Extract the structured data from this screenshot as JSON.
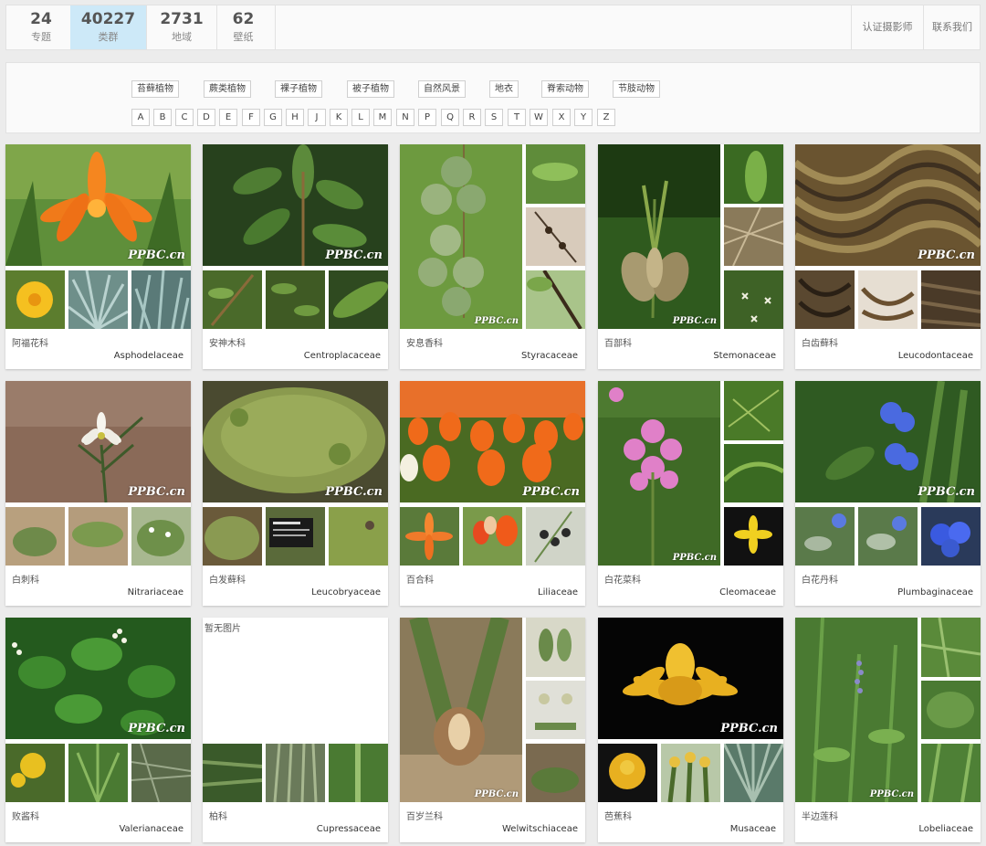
{
  "stats": [
    {
      "num": "24",
      "label": "专题"
    },
    {
      "num": "40227",
      "label": "类群",
      "active": true
    },
    {
      "num": "2731",
      "label": "地域"
    },
    {
      "num": "62",
      "label": "壁纸"
    }
  ],
  "top_links": [
    "认证摄影师",
    "联系我们"
  ],
  "categories": [
    "苔藓植物",
    "蕨类植物",
    "裸子植物",
    "被子植物",
    "自然风景",
    "地衣",
    "脊索动物",
    "节肢动物"
  ],
  "letters": [
    "A",
    "B",
    "C",
    "D",
    "E",
    "F",
    "G",
    "H",
    "J",
    "K",
    "L",
    "M",
    "N",
    "P",
    "Q",
    "R",
    "S",
    "T",
    "W",
    "X",
    "Y",
    "Z"
  ],
  "watermark": "PPBC.cn",
  "no_image_text": "暂无图片",
  "families": [
    {
      "cn": "阿福花科",
      "latin": "Asphodelaceae"
    },
    {
      "cn": "安神木科",
      "latin": "Centroplacaceae"
    },
    {
      "cn": "安息香科",
      "latin": "Styracaceae"
    },
    {
      "cn": "百部科",
      "latin": "Stemonaceae"
    },
    {
      "cn": "白齿藓科",
      "latin": "Leucodontaceae"
    },
    {
      "cn": "白刺科",
      "latin": "Nitrariaceae"
    },
    {
      "cn": "白发藓科",
      "latin": "Leucobryaceae"
    },
    {
      "cn": "百合科",
      "latin": "Liliaceae"
    },
    {
      "cn": "白花菜科",
      "latin": "Cleomaceae"
    },
    {
      "cn": "白花丹科",
      "latin": "Plumbaginaceae"
    },
    {
      "cn": "败酱科",
      "latin": "Valerianaceae"
    },
    {
      "cn": "柏科",
      "latin": "Cupressaceae"
    },
    {
      "cn": "百岁兰科",
      "latin": "Welwitschiaceae"
    },
    {
      "cn": "芭蕉科",
      "latin": "Musaceae"
    },
    {
      "cn": "半边莲科",
      "latin": "Lobeliaceae"
    }
  ]
}
